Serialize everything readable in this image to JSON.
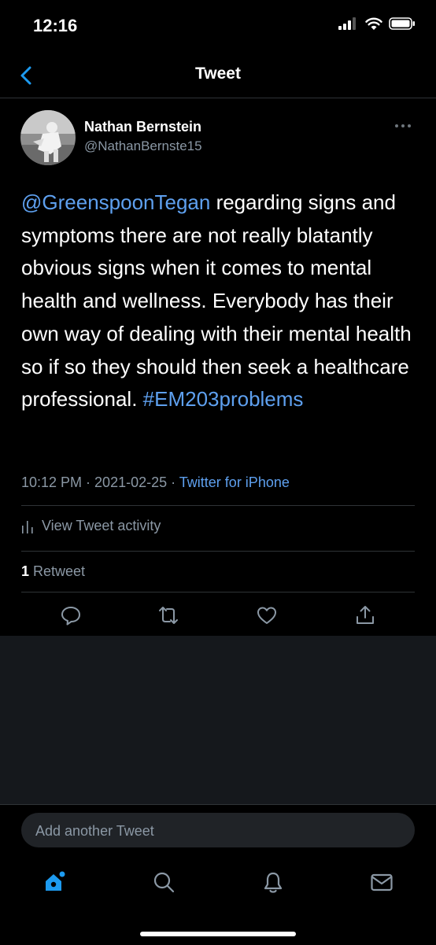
{
  "status_bar": {
    "time": "12:16"
  },
  "nav": {
    "title": "Tweet"
  },
  "author": {
    "name": "Nathan Bernstein",
    "handle": "@NathanBernste15"
  },
  "tweet": {
    "mention": "@GreenspoonTegan",
    "body": " regarding signs and symptoms there are not really blatantly obvious signs when it comes to mental health and wellness. Everybody has their own way of dealing with their mental health so if so they should then seek a healthcare professional. ",
    "hashtag": "#EM203problems"
  },
  "meta": {
    "time": "10:12 PM",
    "sep1": " · ",
    "date": "2021-02-25",
    "sep2": " · ",
    "source": "Twitter for iPhone"
  },
  "activity": {
    "label": "View Tweet activity"
  },
  "stats": {
    "retweet_count": "1",
    "retweet_label": " Retweet"
  },
  "compose": {
    "placeholder": "Add another Tweet"
  },
  "colors": {
    "accent": "#1d9bf0",
    "link": "#5ea0ef",
    "background": "#000000",
    "muted": "#8b98a5"
  },
  "icons": [
    "back-chevron-icon",
    "more-icon",
    "reply-icon",
    "retweet-icon",
    "like-icon",
    "share-icon",
    "home-icon",
    "search-icon",
    "notifications-icon",
    "messages-icon"
  ]
}
